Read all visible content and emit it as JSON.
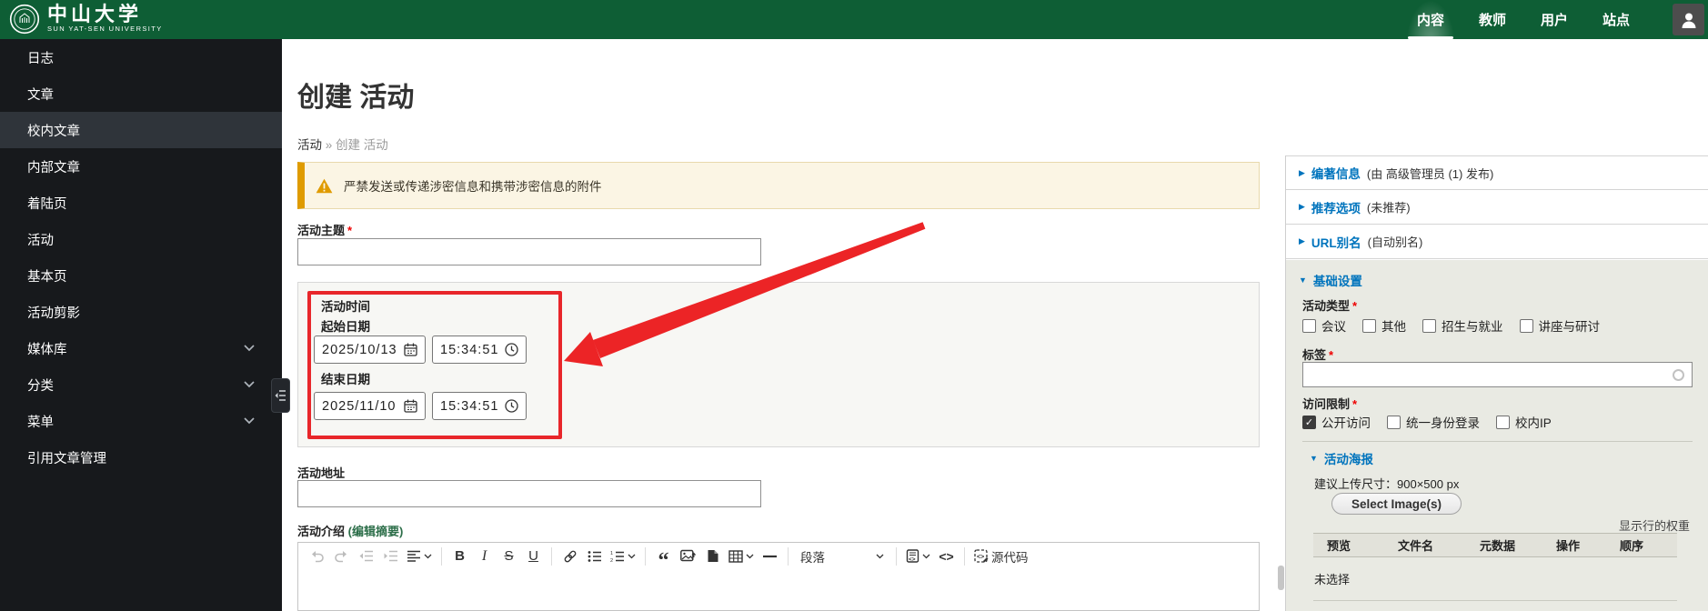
{
  "header": {
    "logo": {
      "university_cn": "中山大学",
      "university_en": "SUN YAT-SEN UNIVERSITY"
    },
    "nav": [
      {
        "label": "内容",
        "active": true
      },
      {
        "label": "教师",
        "active": false
      },
      {
        "label": "用户",
        "active": false
      },
      {
        "label": "站点",
        "active": false
      }
    ]
  },
  "sidebar": {
    "items": [
      {
        "label": "日志"
      },
      {
        "label": "文章"
      },
      {
        "label": "校内文章",
        "active": true
      },
      {
        "label": "内部文章"
      },
      {
        "label": "着陆页"
      },
      {
        "label": "活动"
      },
      {
        "label": "基本页"
      },
      {
        "label": "活动剪影"
      },
      {
        "label": "媒体库",
        "expandable": true
      },
      {
        "label": "分类",
        "expandable": true
      },
      {
        "label": "菜单",
        "expandable": true
      },
      {
        "label": "引用文章管理"
      }
    ]
  },
  "page": {
    "title": "创建 活动",
    "breadcrumb": {
      "parent": "活动",
      "separator": "»",
      "current": "创建 活动"
    },
    "warning_text": "严禁发送或传递涉密信息和携带涉密信息的附件"
  },
  "form": {
    "subject": {
      "label": "活动主题",
      "required_mark": "*",
      "value": ""
    },
    "time_group": {
      "label": "活动时间",
      "start": {
        "label": "起始日期",
        "date": "2025/10/13",
        "time": "15:34:51"
      },
      "end": {
        "label": "结束日期",
        "date": "2025/11/10",
        "time": "15:34:51"
      }
    },
    "address": {
      "label": "活动地址",
      "value": ""
    },
    "intro": {
      "label": "活动介绍",
      "edit_summary": "(编辑摘要)"
    }
  },
  "editor_toolbar": {
    "paragraph_label": "段落",
    "source_label": "源代码",
    "buttons": [
      "undo",
      "redo",
      "outdent",
      "indent",
      "align",
      "bold",
      "italic",
      "strikethrough",
      "underline",
      "link",
      "bulleted-list",
      "numbered-list",
      "blockquote",
      "insert-image",
      "template",
      "table",
      "horizontal-line",
      "paragraph-style",
      "media-embed",
      "code",
      "source-code"
    ]
  },
  "right_panel": {
    "sections": [
      {
        "title": "编著信息",
        "meta": "(由 高级管理员 (1) 发布)",
        "expanded": false
      },
      {
        "title": "推荐选项",
        "meta": "(未推荐)",
        "expanded": false
      },
      {
        "title": "URL别名",
        "meta": "(自动别名)",
        "expanded": false
      },
      {
        "title": "基础设置",
        "meta": "",
        "expanded": true
      }
    ],
    "basic_settings": {
      "activity_type": {
        "label": "活动类型",
        "required_mark": "*",
        "options": [
          {
            "label": "会议",
            "checked": false
          },
          {
            "label": "其他",
            "checked": false
          },
          {
            "label": "招生与就业",
            "checked": false
          },
          {
            "label": "讲座与研讨",
            "checked": false
          }
        ]
      },
      "tags": {
        "label": "标签",
        "required_mark": "*",
        "value": ""
      },
      "access": {
        "label": "访问限制",
        "required_mark": "*",
        "options": [
          {
            "label": "公开访问",
            "checked": true,
            "check_glyph": "✓"
          },
          {
            "label": "统一身份登录",
            "checked": false
          },
          {
            "label": "校内IP",
            "checked": false
          }
        ]
      },
      "poster": {
        "title": "活动海报",
        "hint": "建议上传尺寸：900×500 px",
        "select_button_label": "Select Image(s)",
        "show_weights_label": "显示行的权重",
        "table_headers": [
          "预览",
          "文件名",
          "元数据",
          "操作",
          "顺序"
        ],
        "empty_text": "未选择"
      }
    }
  },
  "colors": {
    "header_green": "#0e5e35",
    "sidebar_bg": "#17191c",
    "sidebar_active": "#2f343a",
    "panel_link_blue": "#0074bd",
    "warning_border_orange": "#df9b00",
    "warning_bg": "#fbf5e4",
    "annotation_red": "#ec2426",
    "basic_section_bg": "#e9eae3",
    "required_red": "#ee0000"
  }
}
